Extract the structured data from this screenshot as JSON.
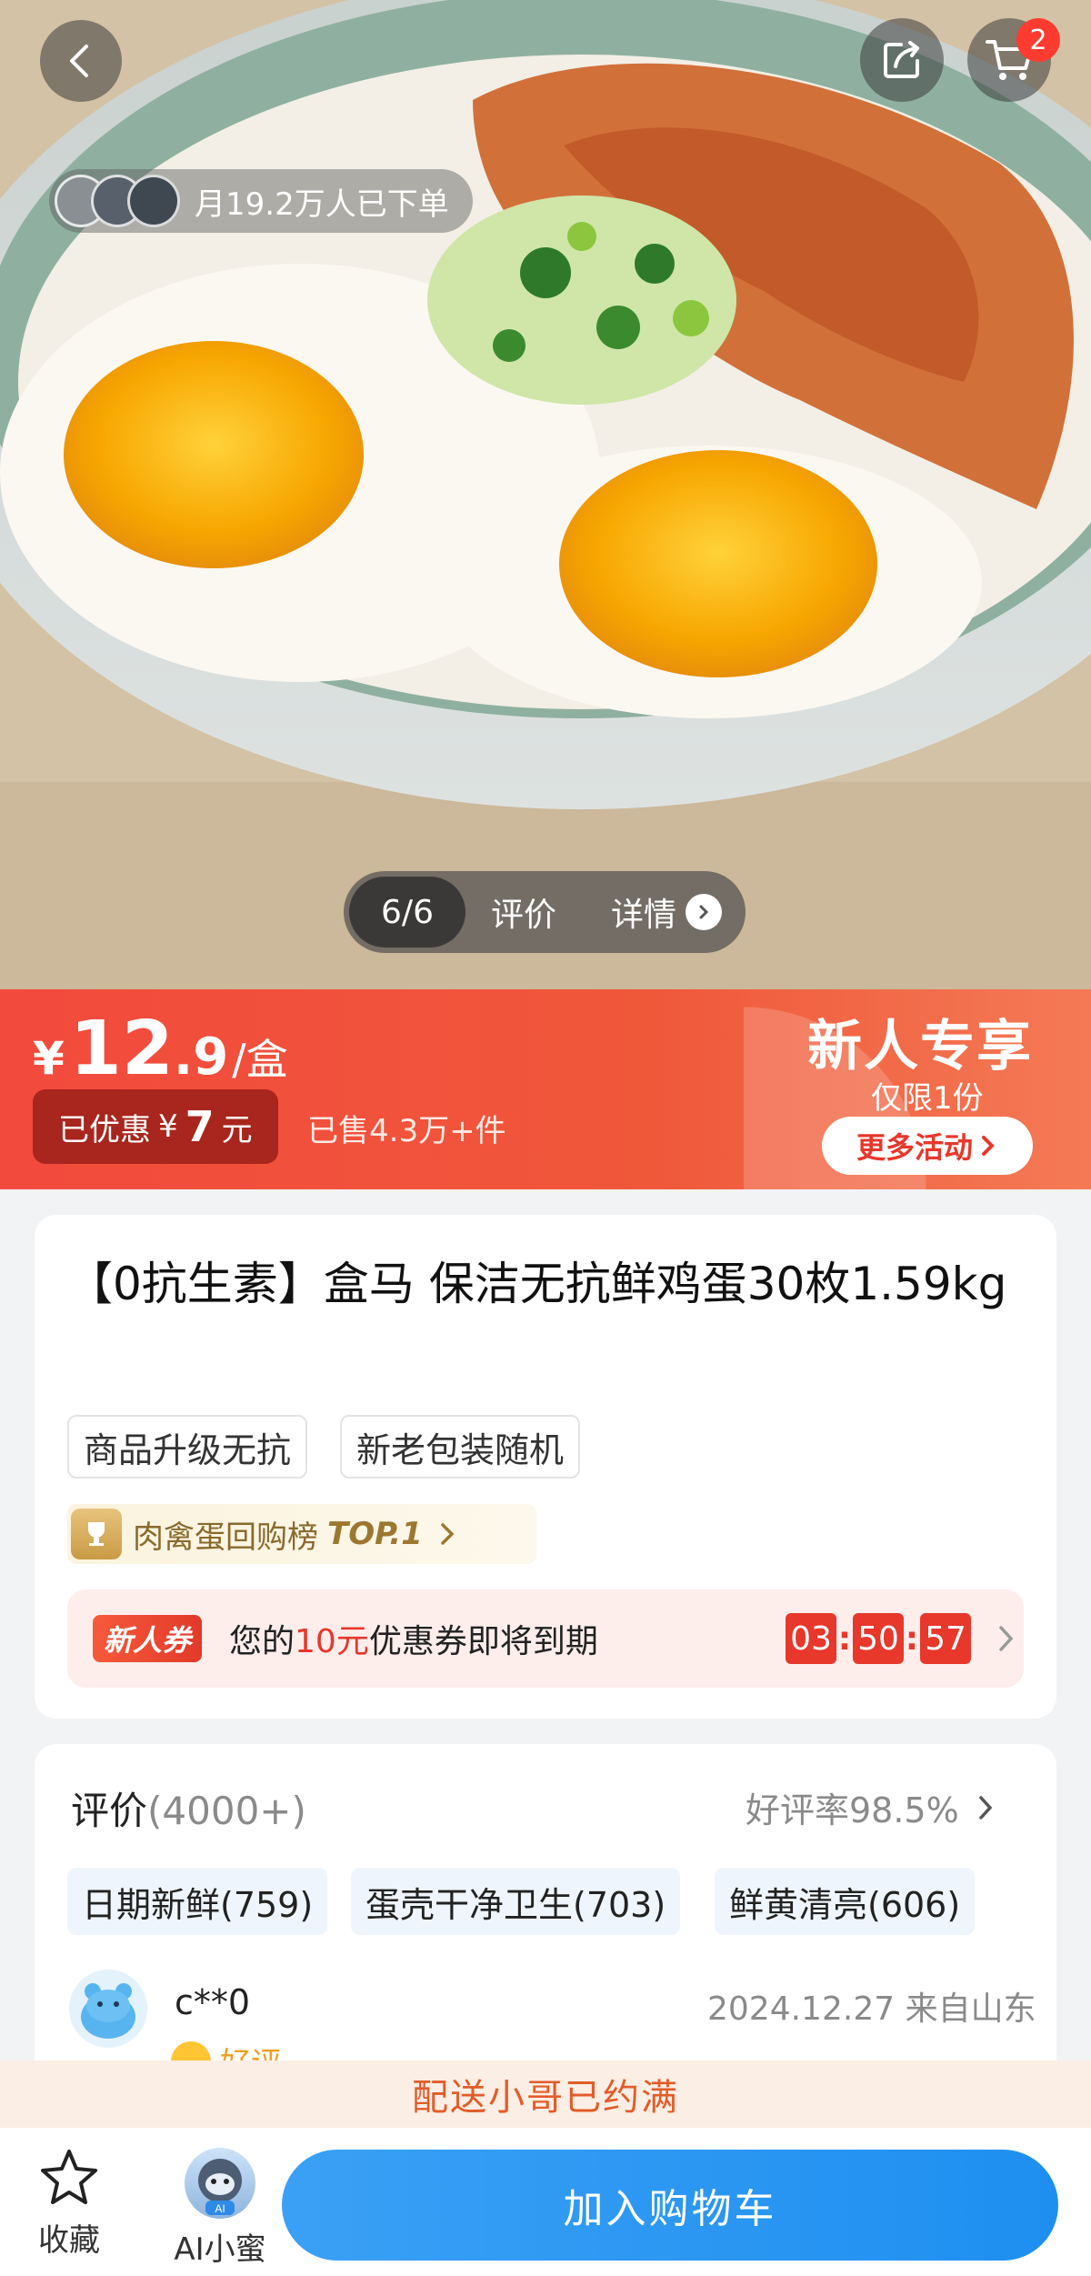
{
  "hero": {
    "buyers_text": "月19.2万人已下单",
    "gallery": {
      "counter": "6/6",
      "reviews_tab": "评价",
      "details_tab": "详情"
    },
    "cart_badge": "2",
    "icons": [
      "back-icon",
      "share-icon",
      "cart-icon"
    ]
  },
  "price": {
    "symbol": "¥",
    "integer": "12",
    "decimal": ".9",
    "unit": "/盒",
    "discount_prefix": "已优惠",
    "discount_symbol": "¥",
    "discount_amount": "7",
    "discount_suffix": "元",
    "sold": "已售4.3万+件",
    "promo_title": "新人专享",
    "promo_sub": "仅限1份",
    "promo_button": "更多活动"
  },
  "product": {
    "title": "【0抗生素】盒马 保洁无抗鲜鸡蛋30枚1.59kg",
    "tags": [
      "商品升级无抗",
      "新老包装随机"
    ],
    "rank_label": "肉禽蛋回购榜",
    "rank_top": "TOP.1",
    "coupon": {
      "badge": "新人券",
      "text_prefix": "您的",
      "amount": "10元",
      "text_suffix": "优惠券即将到期",
      "hours": "03",
      "minutes": "50",
      "seconds": "57"
    }
  },
  "reviews": {
    "title": "评价",
    "count": "(4000+)",
    "rate": "好评率98.5%",
    "tags": [
      "日期新鲜(759)",
      "蛋壳干净卫生(703)",
      "鲜黄清亮(606)"
    ],
    "first": {
      "user": "c**0",
      "meta": "2024.12.27 来自山东",
      "rating": "好评"
    }
  },
  "notice": "配送小哥已约满",
  "bottom_bar": {
    "favorite": "收藏",
    "ai": "AI小蜜",
    "ai_badge": "AI",
    "add_to_cart": "加入购物车"
  },
  "colors": {
    "price_red": "#f24a3d",
    "accent_blue": "#1e8ff0",
    "notice_orange": "#e25c2a"
  }
}
